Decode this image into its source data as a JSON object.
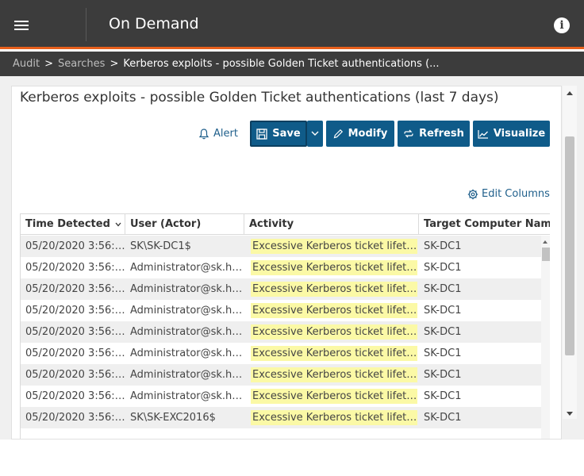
{
  "header": {
    "title": "On Demand",
    "menu_icon": "hamburger-menu-icon",
    "info_icon": "info-icon"
  },
  "breadcrumb": {
    "items": [
      "Audit",
      "Searches"
    ],
    "separator": ">",
    "current": "Kerberos exploits - possible Golden Ticket authentications (..."
  },
  "page": {
    "title": "Kerberos exploits - possible Golden Ticket authentications (last 7 days)"
  },
  "toolbar": {
    "alert_label": "Alert",
    "save_label": "Save",
    "modify_label": "Modify",
    "refresh_label": "Refresh",
    "visualize_label": "Visualize",
    "accent_color": "#0f5b89"
  },
  "edit_columns_label": "Edit Columns",
  "table": {
    "columns": [
      "Time Detected",
      "User (Actor)",
      "Activity",
      "Target Computer Name"
    ],
    "rows": [
      [
        "05/20/2020 3:56:5...",
        "SK\\SK-DC1$",
        "Excessive Kerberos ticket lifetime ...",
        "SK-DC1"
      ],
      [
        "05/20/2020 3:56:3...",
        "Administrator@sk.hal...",
        "Excessive Kerberos ticket lifetime ...",
        "SK-DC1"
      ],
      [
        "05/20/2020 3:56:3...",
        "Administrator@sk.hal...",
        "Excessive Kerberos ticket lifetime ...",
        "SK-DC1"
      ],
      [
        "05/20/2020 3:56:3...",
        "Administrator@sk.hal...",
        "Excessive Kerberos ticket lifetime ...",
        "SK-DC1"
      ],
      [
        "05/20/2020 3:56:3...",
        "Administrator@sk.hal...",
        "Excessive Kerberos ticket lifetime ...",
        "SK-DC1"
      ],
      [
        "05/20/2020 3:56:3...",
        "Administrator@sk.hal...",
        "Excessive Kerberos ticket lifetime ...",
        "SK-DC1"
      ],
      [
        "05/20/2020 3:56:3...",
        "Administrator@sk.hal...",
        "Excessive Kerberos ticket lifetime ...",
        "SK-DC1"
      ],
      [
        "05/20/2020 3:56:3...",
        "Administrator@sk.hal...",
        "Excessive Kerberos ticket lifetime ...",
        "SK-DC1"
      ],
      [
        "05/20/2020 3:56:3...",
        "SK\\SK-EXC2016$",
        "Excessive Kerberos ticket lifetime ...",
        "SK-DC1"
      ]
    ]
  }
}
